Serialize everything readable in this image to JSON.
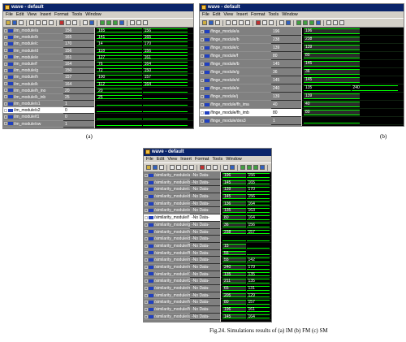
{
  "menu": [
    "File",
    "Edit",
    "View",
    "Insert",
    "Format",
    "Tools",
    "Window"
  ],
  "windows": {
    "a": {
      "title": "wave - default",
      "rows": [
        {
          "name": "/im_module/a",
          "value": "156",
          "segs": [
            "185",
            "156"
          ]
        },
        {
          "name": "/im_module/b",
          "value": "165",
          "segs": [
            "141",
            "165"
          ]
        },
        {
          "name": "/im_module/c",
          "value": "170",
          "segs": [
            "14",
            "170"
          ]
        },
        {
          "name": "/im_module/d",
          "value": "156",
          "segs": [
            "118",
            "156"
          ]
        },
        {
          "name": "/im_module/e",
          "value": "161",
          "segs": [
            "127",
            "161"
          ]
        },
        {
          "name": "/im_module/f",
          "value": "164",
          "segs": [
            "76",
            "164"
          ]
        },
        {
          "name": "/im_module/g",
          "value": "150",
          "segs": [
            "72",
            "150"
          ]
        },
        {
          "name": "/im_module/h",
          "value": "157",
          "segs": [
            "100",
            "157"
          ]
        },
        {
          "name": "/im_module/k",
          "value": "164",
          "segs": [
            "112",
            "164"
          ]
        },
        {
          "name": "/im_module/h_ino",
          "value": "20",
          "segs": [
            "20",
            ""
          ]
        },
        {
          "name": "/im_module/k_inb",
          "value": "25",
          "segs": [
            "25",
            ""
          ]
        },
        {
          "name": "/im_module/s1",
          "value": "1",
          "segs": [
            "",
            ""
          ]
        },
        {
          "name": "/im_module/s2",
          "value": "0",
          "segs": [
            "",
            ""
          ],
          "selected": true
        },
        {
          "name": "/im_module/t1",
          "value": "0",
          "segs": [
            "",
            ""
          ]
        },
        {
          "name": "/im_module/sw",
          "value": "1",
          "segs": [
            "",
            ""
          ]
        }
      ]
    },
    "b": {
      "title": "wave - default",
      "rows": [
        {
          "name": "/finge_module/a",
          "value": "196",
          "segs": [
            "196"
          ]
        },
        {
          "name": "/finge_module/b",
          "value": "238",
          "segs": [
            "238"
          ]
        },
        {
          "name": "/finge_module/c",
          "value": "139",
          "segs": [
            "139"
          ]
        },
        {
          "name": "/finge_module/f",
          "value": "80",
          "segs": [
            "80"
          ]
        },
        {
          "name": "/finge_module/b",
          "value": "145",
          "segs": [
            "145"
          ]
        },
        {
          "name": "/finge_module/g",
          "value": "36",
          "segs": [
            "36"
          ]
        },
        {
          "name": "/finge_module/d",
          "value": "145",
          "segs": [
            "145"
          ]
        },
        {
          "name": "/finge_module/e",
          "value": "240",
          "segs": [
            "135",
            "240"
          ]
        },
        {
          "name": "/finge_module/j",
          "value": "139",
          "segs": [
            "139"
          ]
        },
        {
          "name": "/finge_module/fh_ima",
          "value": "40",
          "segs": [
            "40"
          ]
        },
        {
          "name": "/finge_module/fh_imb",
          "value": "80",
          "segs": [
            "80"
          ],
          "selected": true
        },
        {
          "name": "/finge_module/des3",
          "value": "1",
          "segs": [
            ""
          ]
        }
      ]
    },
    "c": {
      "title": "wave - default",
      "rows": [
        {
          "name": "/similarity_module/a",
          "value": "-No Data-",
          "segs": [
            "196",
            "156"
          ]
        },
        {
          "name": "/similarity_module/b",
          "value": "-No Data-",
          "segs": [
            "145",
            "165"
          ]
        },
        {
          "name": "/similarity_module/c",
          "value": "-No Data-",
          "segs": [
            "139",
            "170"
          ]
        },
        {
          "name": "/similarity_module/d",
          "value": "-No Data-",
          "segs": [
            "145",
            "156"
          ]
        },
        {
          "name": "/similarity_module/e",
          "value": "-No Data-",
          "segs": [
            "136",
            "164"
          ]
        },
        {
          "name": "/similarity_module/e",
          "value": "-No Data-",
          "segs": [
            "135",
            "163"
          ]
        },
        {
          "name": "/similarity_module/f",
          "value": "-No Data-",
          "segs": [
            "80",
            "164"
          ],
          "selected": true
        },
        {
          "name": "/similarity_module/g",
          "value": "-No Data-",
          "segs": [
            "36",
            "156"
          ]
        },
        {
          "name": "/similarity_module/h",
          "value": "-No Data-",
          "segs": [
            "238",
            "157"
          ]
        },
        {
          "name": "/similarity_module/des4",
          "value": "-No Data-",
          "segs": [
            "",
            ""
          ]
        },
        {
          "name": "/similarity_module/fh_ima",
          "value": "-No Data-",
          "segs": [
            "15",
            ""
          ]
        },
        {
          "name": "/similarity_module/fh_imb",
          "value": "-No Data-",
          "segs": [
            "55",
            ""
          ]
        },
        {
          "name": "/similarity_module/mini",
          "value": "-No Data-",
          "segs": [
            "55",
            "142"
          ]
        },
        {
          "name": "/similarity_module/maxi",
          "value": "-No Data-",
          "segs": [
            "240",
            "179"
          ]
        },
        {
          "name": "/similarity_module/t1",
          "value": "-No Data-",
          "segs": [
            "135",
            "135"
          ]
        },
        {
          "name": "/similarity_module/t2",
          "value": "-No Data-",
          "segs": [
            "211",
            "135"
          ]
        },
        {
          "name": "/similarity_module/mean",
          "value": "-No Data-",
          "segs": [
            "65",
            "131"
          ]
        },
        {
          "name": "/similarity_module/mean",
          "value": "-No Data-",
          "segs": [
            "205",
            "129"
          ]
        },
        {
          "name": "/similarity_module/fourth1",
          "value": "-No Data-",
          "segs": [
            "80",
            "157"
          ]
        },
        {
          "name": "/similarity_module/fifth1",
          "value": "-No Data-",
          "segs": [
            "196",
            "161"
          ]
        },
        {
          "name": "/similarity_module/sixth1",
          "value": "-No Data-",
          "segs": [
            "145",
            "164"
          ]
        }
      ]
    }
  },
  "labels": {
    "a": "(a)",
    "b": "(b)"
  },
  "caption": "Fig.24. Simulations results of (a) IM (b) FM (c) SM"
}
